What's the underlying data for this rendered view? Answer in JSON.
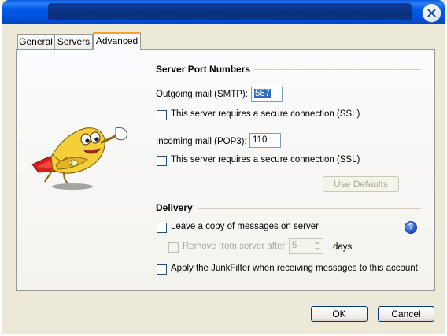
{
  "tabs": [
    {
      "label": "General"
    },
    {
      "label": "Servers"
    },
    {
      "label": "Advanced",
      "selected": true
    }
  ],
  "server_ports": {
    "section_title": "Server Port Numbers",
    "smtp_label": "Outgoing mail (SMTP):",
    "smtp_value": "587",
    "smtp_ssl_label": "This server requires a secure connection (SSL)",
    "pop3_label": "Incoming mail (POP3):",
    "pop3_value": "110",
    "pop3_ssl_label": "This server requires a secure connection (SSL)",
    "use_defaults_label": "Use Defaults"
  },
  "delivery": {
    "section_title": "Delivery",
    "leave_copy_label": "Leave a copy of messages on server",
    "remove_after_label": "Remove from server after",
    "remove_after_value": "5",
    "days_label": "days",
    "junkfilter_label": "Apply the JunkFilter when receiving messages to this account"
  },
  "help_glyph": "?",
  "footer": {
    "ok_label": "OK",
    "cancel_label": "Cancel"
  },
  "colors": {
    "titlebar": "#0053dd",
    "dialog_bg": "#ece9d8",
    "tab_accent": "#f6a22d"
  },
  "icons": {
    "close": "close-x-icon",
    "mascot": "flying-envelope-mascot",
    "help": "help-question-icon"
  }
}
